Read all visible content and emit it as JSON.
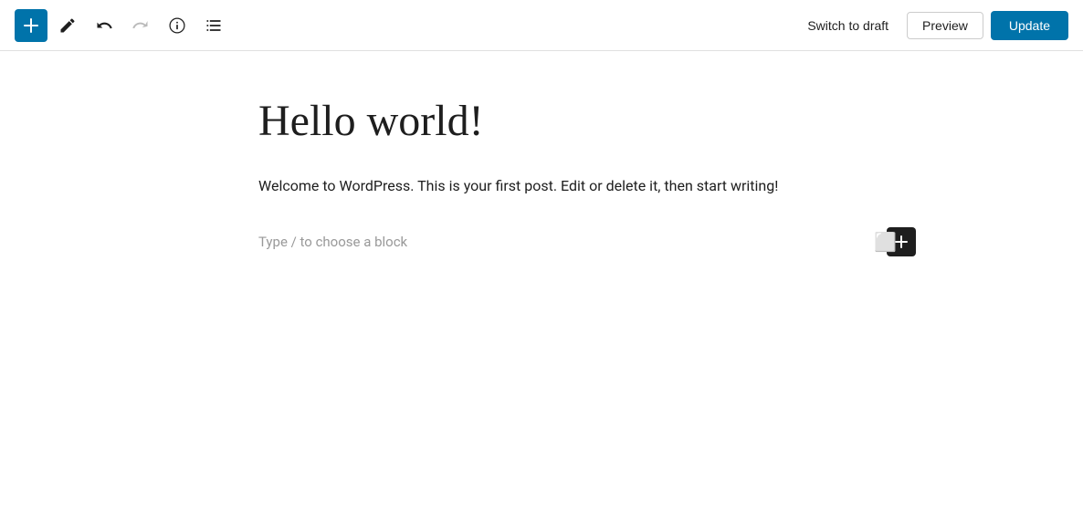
{
  "toolbar": {
    "add_label": "+",
    "switch_draft_label": "Switch to draft",
    "preview_label": "Preview",
    "update_label": "Update"
  },
  "editor": {
    "post_title": "Hello world!",
    "post_content": "Welcome to WordPress. This is your first post. Edit or delete it, then start writing!",
    "block_appender_placeholder": "Type / to choose a block"
  },
  "colors": {
    "brand_blue": "#0073aa",
    "toolbar_border": "#e0e0e0",
    "text_primary": "#1e1e1e",
    "text_muted": "#999"
  }
}
